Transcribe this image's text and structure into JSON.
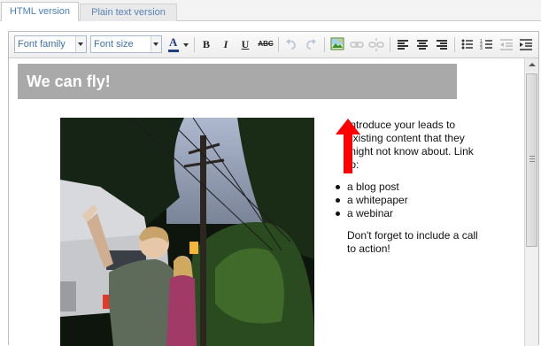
{
  "tabs": {
    "html_version": "HTML version",
    "plain_text_version": "Plain text version"
  },
  "toolbar": {
    "font_family": "Font family",
    "font_size": "Font size",
    "bold": "B",
    "italic": "I",
    "underline": "U",
    "strikethrough": "ABC",
    "font_color": "A"
  },
  "content": {
    "heading": "We can fly!",
    "intro": "Introduce your leads to existing content that they might not know about. Link to:",
    "links": [
      "a blog post",
      "a whitepaper",
      "a webinar"
    ],
    "closing": "Don't forget to include a call to action!"
  },
  "colors": {
    "accent": "#4a7ebb",
    "heading_bg": "#a9a9a9",
    "annotation_arrow": "#ff0000"
  }
}
